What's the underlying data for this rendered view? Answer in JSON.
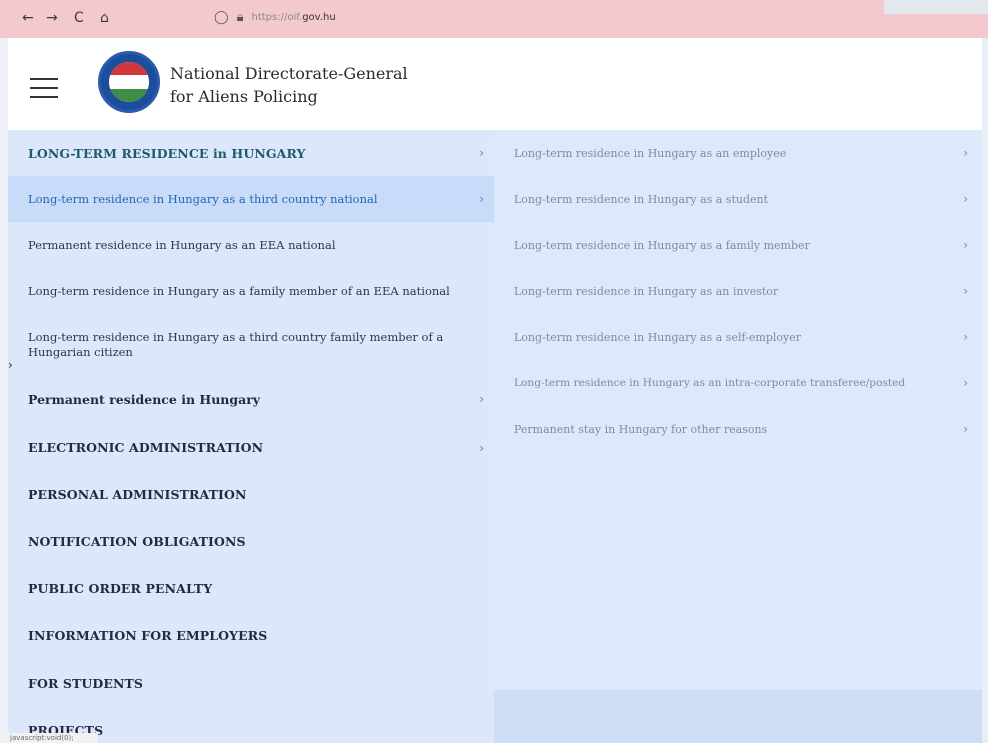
{
  "browser": {
    "back_icon": "←",
    "forward_icon": "→",
    "reload_icon": "C",
    "home_icon": "⌂",
    "url_prefix": "https://oif.",
    "url_domain": "gov.hu"
  },
  "header": {
    "org_line1": "National Directorate-General",
    "org_line2": "for Aliens Policing"
  },
  "menu": {
    "section_title": "LONG-TERM RESIDENCE in HUNGARY",
    "items": [
      {
        "label": "Long-term residence in Hungary as a third country national"
      },
      {
        "label": "Permanent residence in Hungary as an EEA national"
      },
      {
        "label": "Long-term residence in Hungary as a family member of an EEA national"
      },
      {
        "label": "Long-term residence in Hungary as a third country family member of a Hungarian citizen"
      },
      {
        "label": "Permanent residence in Hungary"
      }
    ],
    "top_level": [
      {
        "label": "ELECTRONIC ADMINISTRATION"
      },
      {
        "label": "PERSONAL ADMINISTRATION"
      },
      {
        "label": "NOTIFICATION OBLIGATIONS"
      },
      {
        "label": "PUBLIC ORDER PENALTY"
      },
      {
        "label": "INFORMATION FOR EMPLOYERS"
      },
      {
        "label": "FOR STUDENTS"
      },
      {
        "label": "PROJECTS"
      }
    ]
  },
  "submenu": {
    "items": [
      {
        "label": "Long-term residence in Hungary as an employee"
      },
      {
        "label": "Long-term residence in Hungary as a student"
      },
      {
        "label": "Long-term residence in Hungary as a family member"
      },
      {
        "label": "Long-term residence in Hungary as an investor"
      },
      {
        "label": "Long-term residence in Hungary as a self-employer"
      },
      {
        "label": "Long-term residence in Hungary as an intra-corporate transferee/posted"
      },
      {
        "label": "Permanent stay in Hungary for other reasons"
      }
    ]
  },
  "chevron": "›",
  "status_text": "javascript:void(0);",
  "colors": {
    "panel_left": "#dce7fb",
    "panel_right": "#dde8fb",
    "active_row": "#c8dbf8",
    "active_text": "#2466b8",
    "section_title": "#1e5a6a",
    "browser_bar": "#f3c9cf"
  }
}
